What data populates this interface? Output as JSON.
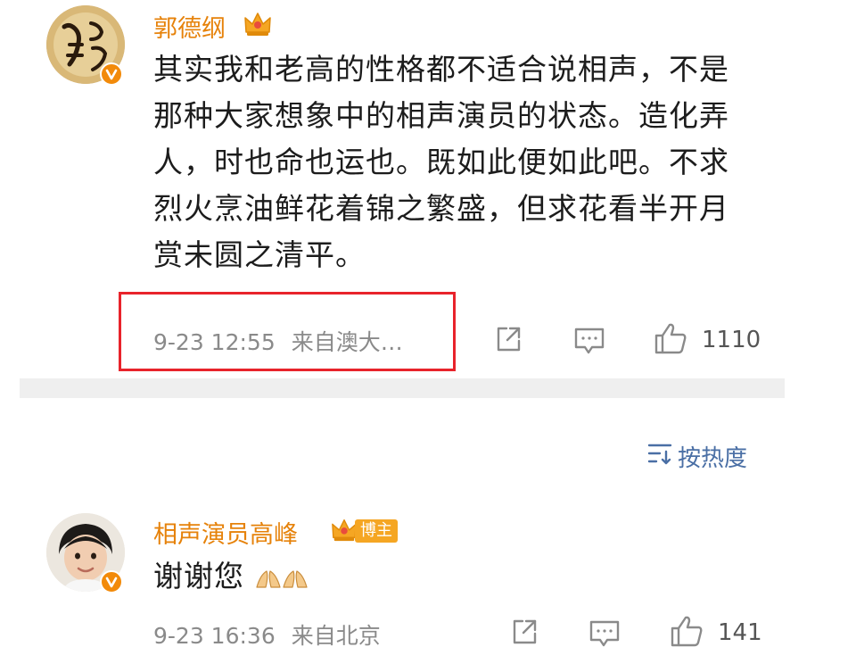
{
  "post": {
    "author": "郭德纲",
    "text_lines": [
      "其实我和老高的性格都不适合说相声，不是",
      "那种大家想象中的相声演员的状态。造化弄",
      "人，时也命也运也。既如此便如此吧。不求",
      "烈火烹油鲜花着锦之繁盛，但求花看半开月",
      "赏未圆之清平。"
    ],
    "timestamp": "9-23 12:55",
    "location": "来自澳大…",
    "like_count": "1110"
  },
  "sort": {
    "label": "按热度"
  },
  "reply": {
    "author": "相声演员高峰",
    "badge_label": "博主",
    "text": "谢谢您",
    "timestamp": "9-23 16:36",
    "location": "来自北京",
    "like_count": "141"
  },
  "colors": {
    "username": "#e6820a",
    "verified_badge": "#f28a0a",
    "highlight_box": "#e8232b",
    "sort_link": "#4a6fa5",
    "divider": "#efefef"
  },
  "icons": {
    "share": "share-icon",
    "comment": "comment-icon",
    "like": "thumbs-up-icon",
    "crown": "crown-icon",
    "verified": "verified-v-icon",
    "sort": "sort-icon",
    "emoji": "praying-hands-icon"
  }
}
